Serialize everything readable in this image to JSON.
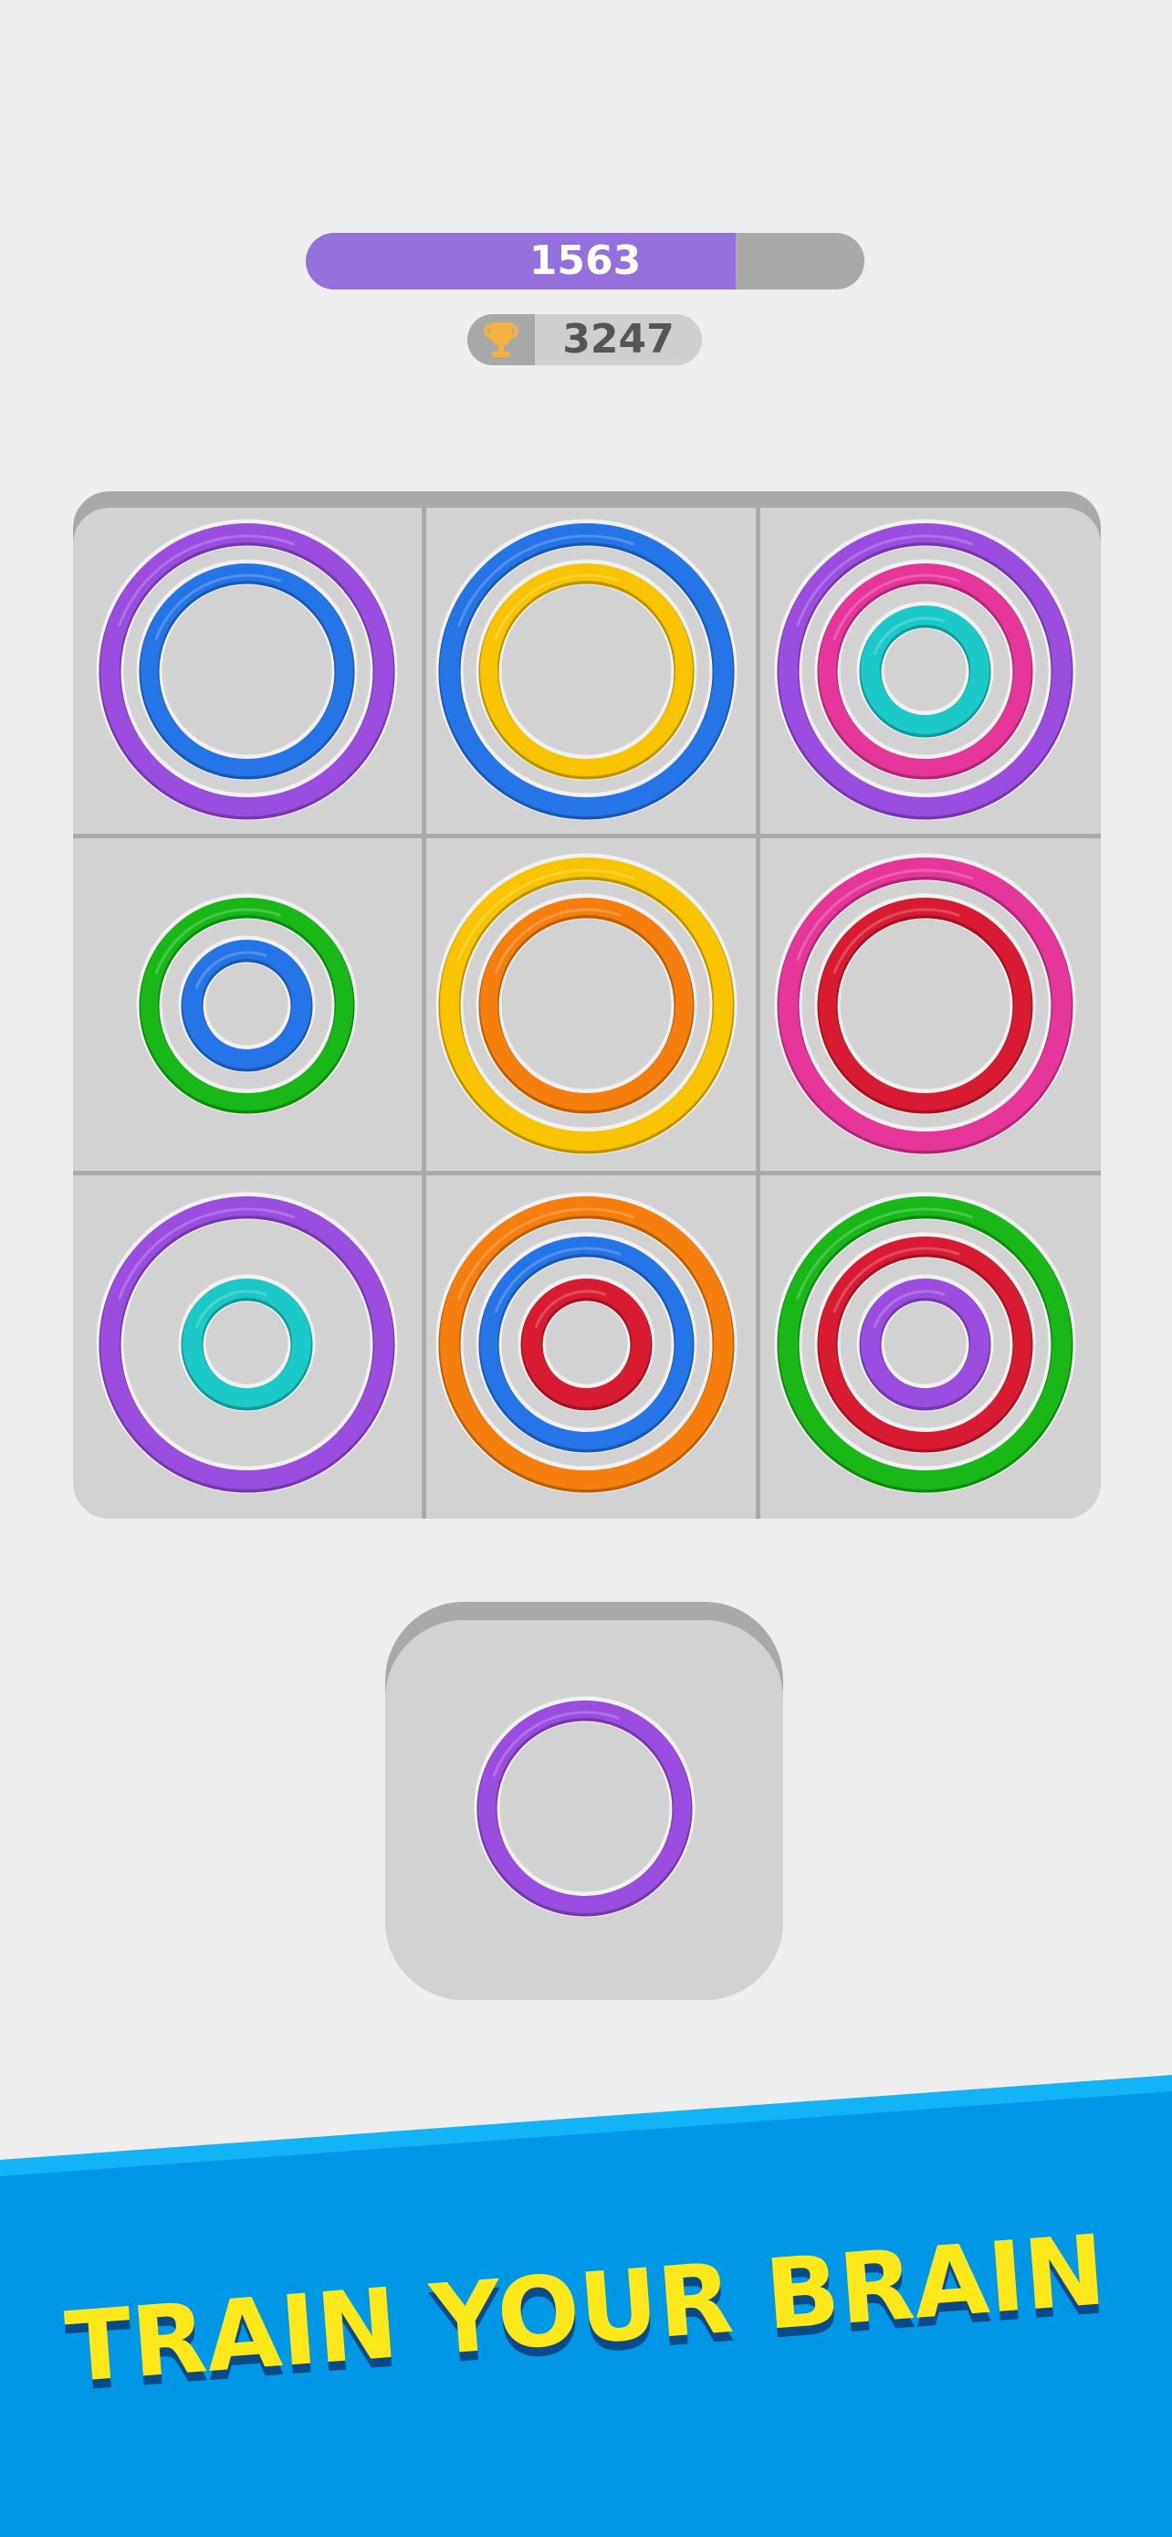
{
  "score": {
    "value": "1563",
    "progress_fraction": 0.77,
    "fill_color": "#9370dc",
    "track_color": "#a9a9a9"
  },
  "best": {
    "icon": "trophy-icon",
    "value": "3247"
  },
  "colors": {
    "purple": "#9b4de0",
    "blue": "#2575e8",
    "yellow": "#f8c400",
    "pink": "#e6369a",
    "teal": "#1cc9c9",
    "green": "#18b818",
    "orange": "#f57e0c",
    "red": "#d81b30"
  },
  "board": {
    "cells": [
      [
        {
          "size": "large",
          "color": "purple"
        },
        {
          "size": "medium",
          "color": "blue"
        }
      ],
      [
        {
          "size": "large",
          "color": "blue"
        },
        {
          "size": "medium",
          "color": "yellow"
        }
      ],
      [
        {
          "size": "large",
          "color": "purple"
        },
        {
          "size": "medium",
          "color": "pink"
        },
        {
          "size": "small",
          "color": "teal"
        }
      ],
      [
        {
          "size": "medium",
          "color": "green"
        },
        {
          "size": "small",
          "color": "blue"
        }
      ],
      [
        {
          "size": "large",
          "color": "yellow"
        },
        {
          "size": "medium",
          "color": "orange"
        }
      ],
      [
        {
          "size": "large",
          "color": "pink"
        },
        {
          "size": "medium",
          "color": "red"
        }
      ],
      [
        {
          "size": "large",
          "color": "purple"
        },
        {
          "size": "small",
          "color": "teal"
        }
      ],
      [
        {
          "size": "large",
          "color": "orange"
        },
        {
          "size": "medium",
          "color": "blue"
        },
        {
          "size": "small",
          "color": "red"
        }
      ],
      [
        {
          "size": "large",
          "color": "green"
        },
        {
          "size": "medium",
          "color": "red"
        },
        {
          "size": "small",
          "color": "purple"
        }
      ]
    ]
  },
  "next_piece": [
    {
      "size": "medium",
      "color": "purple"
    }
  ],
  "banner": {
    "text": "TRAIN YOUR BRAIN",
    "background_color": "#0098e6",
    "text_color": "#ffe81a"
  }
}
